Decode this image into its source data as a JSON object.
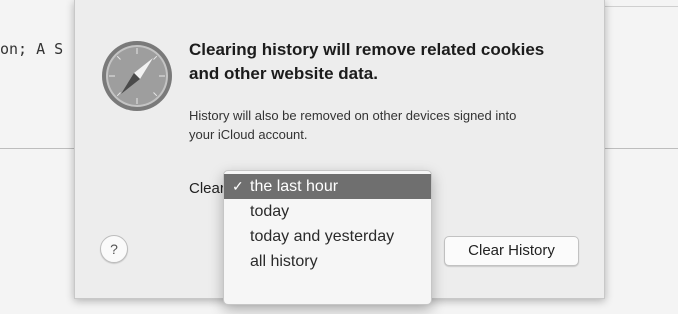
{
  "background": {
    "left_text": "on; A S"
  },
  "dialog": {
    "app_icon": "safari-compass-icon",
    "title_line1": "Clearing history will remove related cookies",
    "title_line2": "and other website data.",
    "description_line1": "History will also be removed on other devices signed into",
    "description_line2": "your iCloud account.",
    "clear_label": "Clear",
    "help_label": "?",
    "primary_button": "Clear History"
  },
  "dropdown": {
    "check_mark": "✓",
    "options": [
      "the last hour",
      "today",
      "today and yesterday",
      "all history"
    ],
    "selected_index": 0
  },
  "colors": {
    "sheet_bg": "#ededed",
    "menu_highlight": "#6f6f6f"
  }
}
